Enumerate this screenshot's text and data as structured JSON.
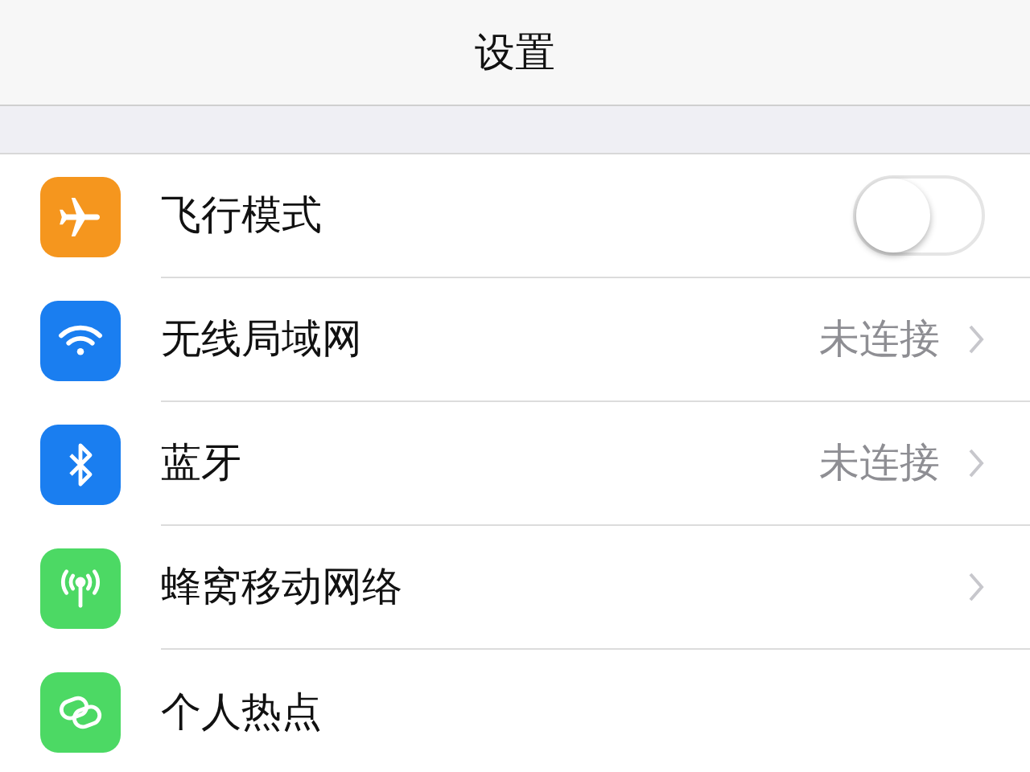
{
  "header": {
    "title": "设置"
  },
  "rows": [
    {
      "label": "飞行模式",
      "color": "#f5961e",
      "kind": "toggle",
      "on": false
    },
    {
      "label": "无线局域网",
      "color": "#1a7ef0",
      "kind": "detail",
      "value": "未连接"
    },
    {
      "label": "蓝牙",
      "color": "#1a7ef0",
      "kind": "detail",
      "value": "未连接"
    },
    {
      "label": "蜂窝移动网络",
      "color": "#4cd964",
      "kind": "link"
    },
    {
      "label": "个人热点",
      "color": "#4cd964",
      "kind": "plain"
    }
  ]
}
